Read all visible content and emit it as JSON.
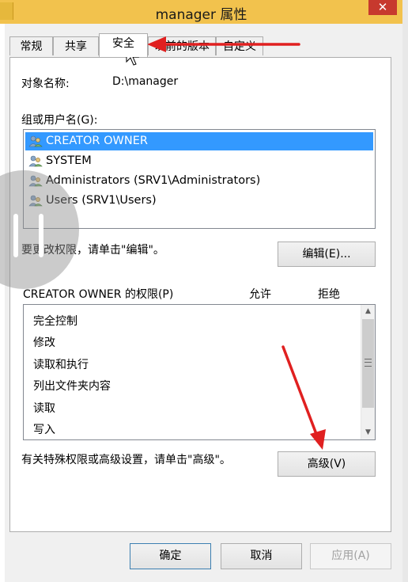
{
  "window": {
    "title": "manager 属性",
    "close_glyph": "✕"
  },
  "tabs": [
    {
      "label": "常规",
      "active": false
    },
    {
      "label": "共享",
      "active": false
    },
    {
      "label": "安全",
      "active": true
    },
    {
      "label": "以前的版本",
      "active": false
    },
    {
      "label": "自定义",
      "active": false
    }
  ],
  "security": {
    "object_name_label": "对象名称:",
    "object_name_value": "D:\\manager",
    "groups_label": "组或用户名(G):",
    "users": [
      {
        "name": "CREATOR OWNER",
        "selected": true,
        "icon": "users-icon"
      },
      {
        "name": "SYSTEM",
        "selected": false,
        "icon": "users-icon"
      },
      {
        "name": "Administrators (SRV1\\Administrators)",
        "selected": false,
        "icon": "users-icon"
      },
      {
        "name": "Users (SRV1\\Users)",
        "selected": false,
        "icon": "users-icon"
      }
    ],
    "edit_hint": "要更改权限，请单击\"编辑\"。",
    "edit_button": "编辑(E)...",
    "permissions_label": "CREATOR OWNER 的权限(P)",
    "allow_header": "允许",
    "deny_header": "拒绝",
    "permissions": [
      "完全控制",
      "修改",
      "读取和执行",
      "列出文件夹内容",
      "读取",
      "写入"
    ],
    "advanced_hint": "有关特殊权限或高级设置，请单击\"高级\"。",
    "advanced_button": "高级(V)"
  },
  "footer": {
    "ok": "确定",
    "cancel": "取消",
    "apply": "应用(A)"
  },
  "colors": {
    "selection": "#3399ff",
    "annotation_arrow": "#e02020"
  }
}
